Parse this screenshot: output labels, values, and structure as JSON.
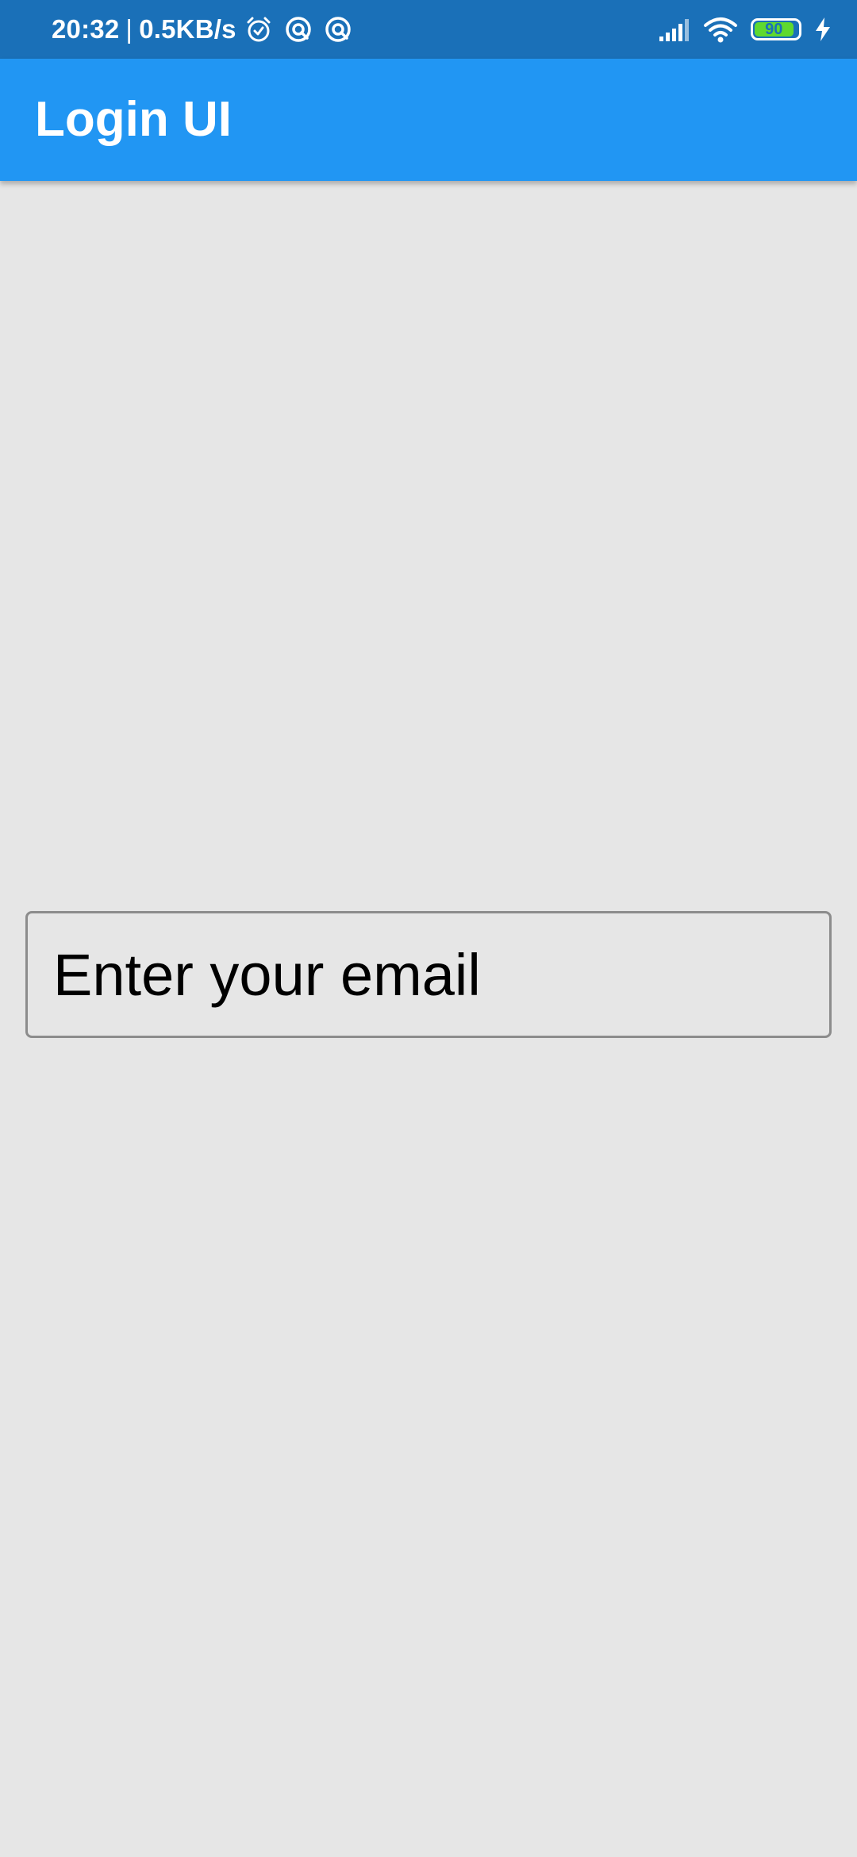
{
  "status_bar": {
    "time": "20:32",
    "separator": "|",
    "network_speed": "0.5KB/s",
    "battery_level": "90",
    "battery_fraction": 0.9,
    "icons": [
      "alarm-icon",
      "sync-icon",
      "sync-icon",
      "signal-icon",
      "wifi-icon",
      "battery-icon",
      "charging-icon"
    ],
    "bar_color": "#1a70b8"
  },
  "app_bar": {
    "title": "Login UI",
    "color": "#2196f3"
  },
  "email_field": {
    "placeholder": "Enter your email",
    "value": ""
  },
  "background_color": "#e6e6e6"
}
